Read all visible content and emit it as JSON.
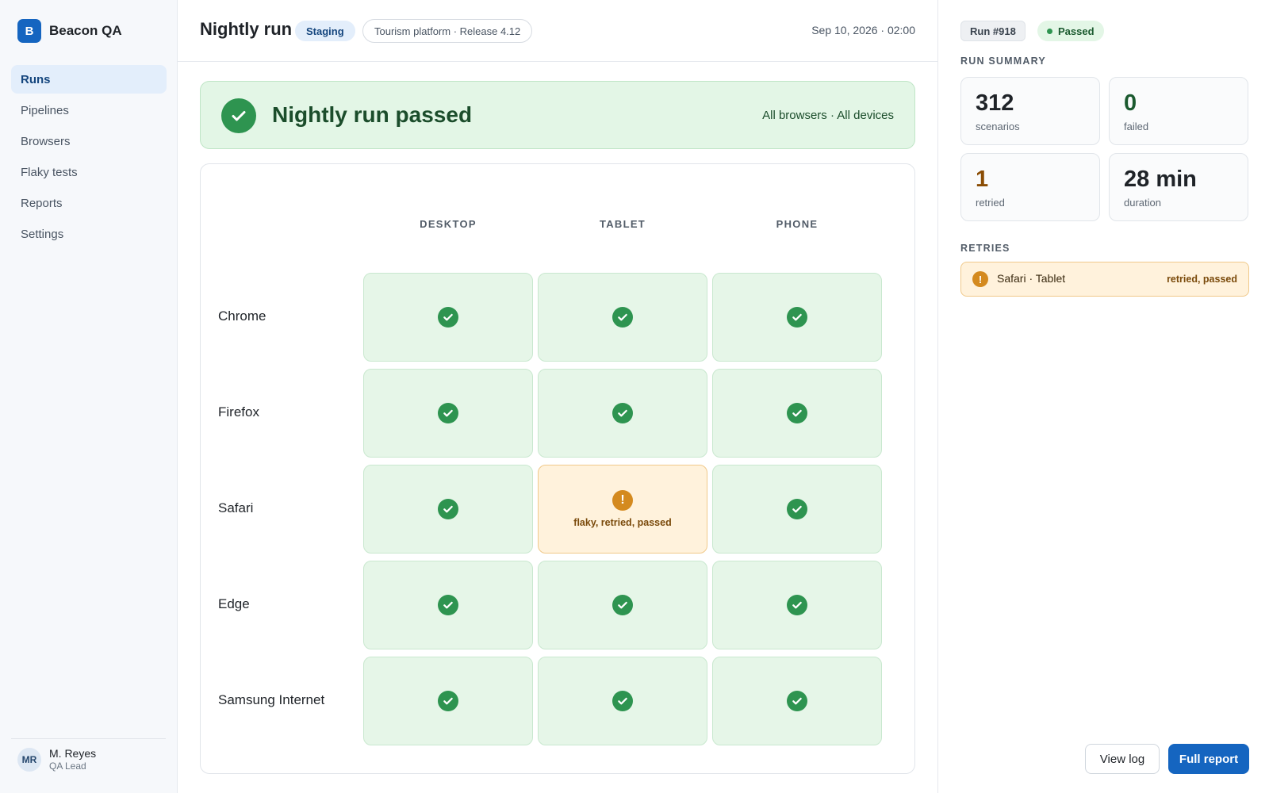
{
  "app": {
    "logo_letter": "B",
    "name": "Beacon QA"
  },
  "sidebar": {
    "items": [
      {
        "label": "Runs",
        "active": true
      },
      {
        "label": "Pipelines",
        "active": false
      },
      {
        "label": "Browsers",
        "active": false
      },
      {
        "label": "Flaky tests",
        "active": false
      },
      {
        "label": "Reports",
        "active": false
      },
      {
        "label": "Settings",
        "active": false
      }
    ]
  },
  "user": {
    "initials": "MR",
    "name": "M. Reyes",
    "role": "QA Lead"
  },
  "header": {
    "title": "Nightly run",
    "environment": "Staging",
    "project": "Tourism platform · Release 4.12",
    "timestamp": "Sep 10, 2026 · 02:00"
  },
  "banner": {
    "title": "Nightly run passed",
    "scope": "All browsers · All devices",
    "icon": "check-circle-icon"
  },
  "matrix": {
    "columns": [
      "DESKTOP",
      "TABLET",
      "PHONE"
    ],
    "rows": [
      {
        "browser": "Chrome",
        "cells": [
          {
            "status": "passed",
            "note": ""
          },
          {
            "status": "passed",
            "note": ""
          },
          {
            "status": "passed",
            "note": ""
          }
        ]
      },
      {
        "browser": "Firefox",
        "cells": [
          {
            "status": "passed",
            "note": ""
          },
          {
            "status": "passed",
            "note": ""
          },
          {
            "status": "passed",
            "note": ""
          }
        ]
      },
      {
        "browser": "Safari",
        "cells": [
          {
            "status": "passed",
            "note": ""
          },
          {
            "status": "flaky",
            "note": "flaky, retried, passed"
          },
          {
            "status": "passed",
            "note": ""
          }
        ]
      },
      {
        "browser": "Edge",
        "cells": [
          {
            "status": "passed",
            "note": ""
          },
          {
            "status": "passed",
            "note": ""
          },
          {
            "status": "passed",
            "note": ""
          }
        ]
      },
      {
        "browser": "Samsung Internet",
        "cells": [
          {
            "status": "passed",
            "note": ""
          },
          {
            "status": "passed",
            "note": ""
          },
          {
            "status": "passed",
            "note": ""
          }
        ]
      }
    ]
  },
  "panel": {
    "run_id": "Run #918",
    "status": "Passed",
    "summary_title": "RUN SUMMARY",
    "stats": [
      {
        "value": "312",
        "label": "scenarios",
        "color": "#1f2328"
      },
      {
        "value": "0",
        "label": "failed",
        "color": "#1b5a2f"
      },
      {
        "value": "1",
        "label": "retried",
        "color": "#8a4d05"
      },
      {
        "value": "28 min",
        "label": "duration",
        "color": "#1f2328"
      }
    ],
    "retries_title": "RETRIES",
    "retries": [
      {
        "name": "Safari · Tablet",
        "result": "retried, passed"
      }
    ],
    "buttons": {
      "view_log": "View log",
      "full_report": "Full report"
    }
  },
  "colors": {
    "accent": "#1565c0",
    "pass": "#2e9450",
    "warn": "#d48a1f"
  }
}
